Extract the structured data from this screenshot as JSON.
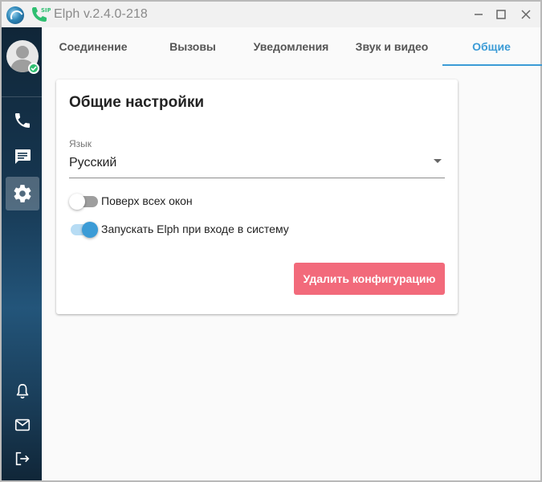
{
  "window": {
    "title": "Elph v.2.4.0-218",
    "sip_badge": "SIP"
  },
  "sidebar": {
    "items": [
      {
        "name": "calls",
        "icon": "phone-icon"
      },
      {
        "name": "chat",
        "icon": "chat-icon"
      },
      {
        "name": "settings",
        "icon": "gear-icon",
        "active": true
      },
      {
        "name": "notifications",
        "icon": "bell-icon"
      },
      {
        "name": "mail",
        "icon": "mail-icon"
      },
      {
        "name": "logout",
        "icon": "logout-icon"
      }
    ],
    "status_color": "#2fbf71"
  },
  "tabs": [
    {
      "label": "Соединение"
    },
    {
      "label": "Вызовы"
    },
    {
      "label": "Уведомления"
    },
    {
      "label": "Звук и видео"
    },
    {
      "label": "Общие",
      "active": true
    }
  ],
  "settings": {
    "title": "Общие настройки",
    "language_label": "Язык",
    "language_value": "Русский",
    "always_on_top_label": "Поверх всех окон",
    "always_on_top_enabled": false,
    "autostart_label": "Запускать Elph при входе в систему",
    "autostart_enabled": true,
    "delete_config_label": "Удалить конфигурацию"
  },
  "colors": {
    "accent": "#3b9bd6",
    "danger": "#f26a7b",
    "sidebar_dark": "#102638",
    "sidebar_mid": "#23557a"
  }
}
